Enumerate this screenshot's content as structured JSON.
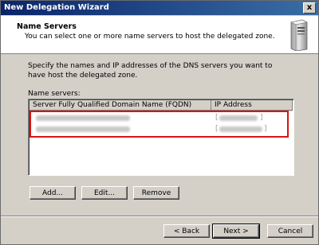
{
  "window": {
    "title": "New Delegation Wizard",
    "close_glyph": "x"
  },
  "header": {
    "title": "Name Servers",
    "subtitle": "You can select one or more name servers to host the delegated zone."
  },
  "body": {
    "description": "Specify the names and IP addresses of the DNS servers you want to have host the delegated zone.",
    "name_servers_label": "Name servers:"
  },
  "table": {
    "columns": [
      "Server Fully Qualified Domain Name (FQDN)",
      "IP Address"
    ],
    "rows": [
      {
        "fqdn": "",
        "ip": "[",
        "ip_end": "]"
      },
      {
        "fqdn": "",
        "ip": "[",
        "ip_end": "]"
      }
    ],
    "highlight_color": "#d81414"
  },
  "actions": {
    "add": "Add...",
    "edit": "Edit...",
    "remove": "Remove"
  },
  "nav": {
    "back": "< Back",
    "next": "Next >",
    "cancel": "Cancel"
  },
  "icons": {
    "header": "server-icon"
  }
}
